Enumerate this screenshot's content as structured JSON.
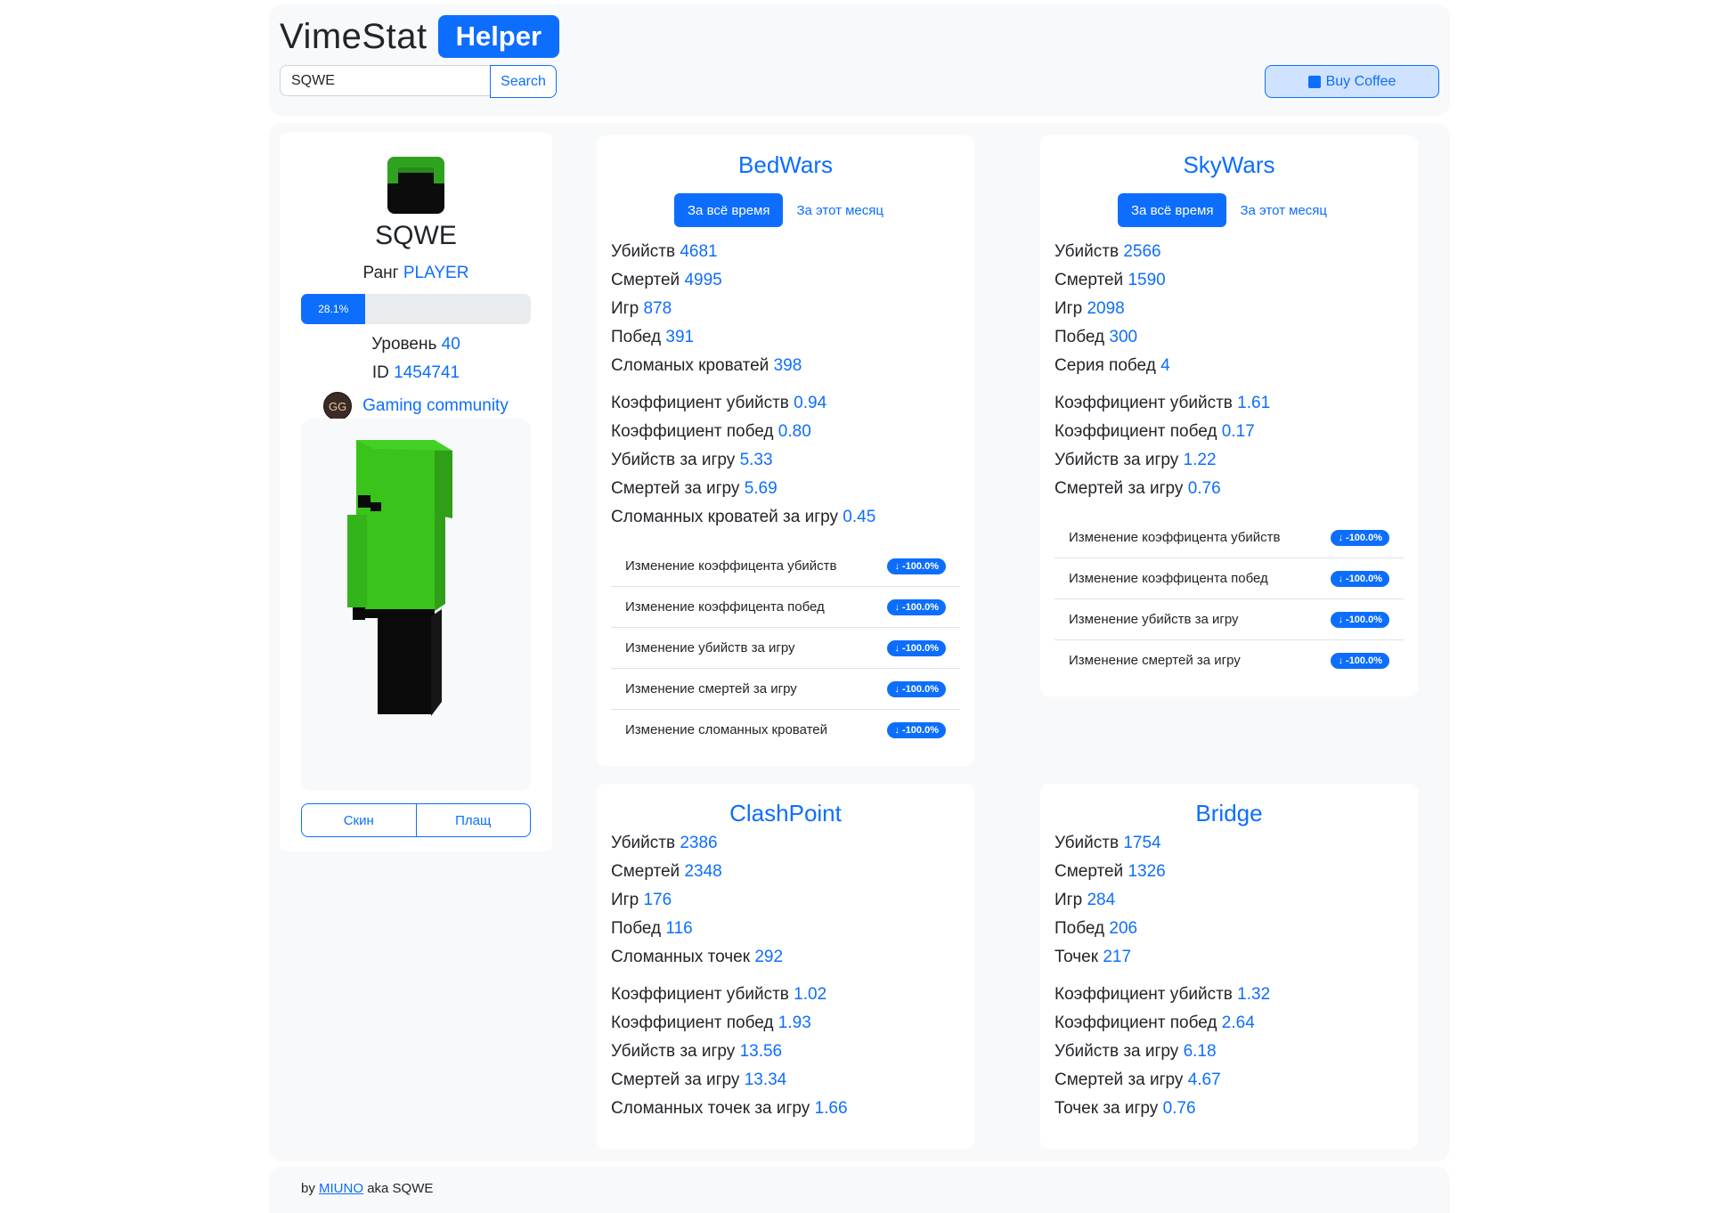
{
  "header": {
    "title": "VimeStat",
    "badge": "Helper",
    "search_value": "SQWE",
    "search_button": "Search",
    "coffee_button": "Buy Coffee"
  },
  "profile": {
    "name": "SQWE",
    "rank_label": "Ранг",
    "rank": "PLAYER",
    "progress_text": "28.1%",
    "progress_value": 28.1,
    "level_label": "Уровень",
    "level": "40",
    "id_label": "ID",
    "id": "1454741",
    "guild_icon_text": "GG",
    "guild": "Gaming community",
    "skin_button": "Скин",
    "cape_button": "Плащ"
  },
  "bedwars": {
    "title": "BedWars",
    "tab_all": "За всё время",
    "tab_month": "За этот месяц",
    "stats": [
      {
        "label": "Убийств",
        "value": "4681"
      },
      {
        "label": "Смертей",
        "value": "4995"
      },
      {
        "label": "Игр",
        "value": "878"
      },
      {
        "label": "Побед",
        "value": "391"
      },
      {
        "label": "Сломаных кроватей",
        "value": "398"
      }
    ],
    "ratios": [
      {
        "label": "Коэффициент убийств",
        "value": "0.94"
      },
      {
        "label": "Коэффициент побед",
        "value": "0.80"
      },
      {
        "label": "Убийств за игру",
        "value": "5.33"
      },
      {
        "label": "Смертей за игру",
        "value": "5.69"
      },
      {
        "label": "Сломанных кроватей за игру",
        "value": "0.45"
      }
    ],
    "changes": [
      {
        "label": "Изменение коэффицента убийств",
        "value": "↓ -100.0%"
      },
      {
        "label": "Изменение коэффицента побед",
        "value": "↓ -100.0%"
      },
      {
        "label": "Изменение убийств за игру",
        "value": "↓ -100.0%"
      },
      {
        "label": "Изменение смертей за игру",
        "value": "↓ -100.0%"
      },
      {
        "label": "Изменение сломанных кроватей",
        "value": "↓ -100.0%"
      }
    ]
  },
  "skywars": {
    "title": "SkyWars",
    "tab_all": "За всё время",
    "tab_month": "За этот месяц",
    "stats": [
      {
        "label": "Убийств",
        "value": "2566"
      },
      {
        "label": "Смертей",
        "value": "1590"
      },
      {
        "label": "Игр",
        "value": "2098"
      },
      {
        "label": "Побед",
        "value": "300"
      },
      {
        "label": "Серия побед",
        "value": "4"
      }
    ],
    "ratios": [
      {
        "label": "Коэффициент убийств",
        "value": "1.61"
      },
      {
        "label": "Коэффициент побед",
        "value": "0.17"
      },
      {
        "label": "Убийств за игру",
        "value": "1.22"
      },
      {
        "label": "Смертей за игру",
        "value": "0.76"
      }
    ],
    "changes": [
      {
        "label": "Изменение коэффицента убийств",
        "value": "↓ -100.0%"
      },
      {
        "label": "Изменение коэффицента побед",
        "value": "↓ -100.0%"
      },
      {
        "label": "Изменение убийств за игру",
        "value": "↓ -100.0%"
      },
      {
        "label": "Изменение смертей за игру",
        "value": "↓ -100.0%"
      }
    ]
  },
  "clashpoint": {
    "title": "ClashPoint",
    "stats": [
      {
        "label": "Убийств",
        "value": "2386"
      },
      {
        "label": "Смертей",
        "value": "2348"
      },
      {
        "label": "Игр",
        "value": "176"
      },
      {
        "label": "Побед",
        "value": "116"
      },
      {
        "label": "Сломанных точек",
        "value": "292"
      }
    ],
    "ratios": [
      {
        "label": "Коэффициент убийств",
        "value": "1.02"
      },
      {
        "label": "Коэффициент побед",
        "value": "1.93"
      },
      {
        "label": "Убийств за игру",
        "value": "13.56"
      },
      {
        "label": "Смертей за игру",
        "value": "13.34"
      },
      {
        "label": "Сломанных точек за игру",
        "value": "1.66"
      }
    ]
  },
  "bridge": {
    "title": "Bridge",
    "stats": [
      {
        "label": "Убийств",
        "value": "1754"
      },
      {
        "label": "Смертей",
        "value": "1326"
      },
      {
        "label": "Игр",
        "value": "284"
      },
      {
        "label": "Побед",
        "value": "206"
      },
      {
        "label": "Точек",
        "value": "217"
      }
    ],
    "ratios": [
      {
        "label": "Коэффициент убийств",
        "value": "1.32"
      },
      {
        "label": "Коэффициент побед",
        "value": "2.64"
      },
      {
        "label": "Убийств за игру",
        "value": "6.18"
      },
      {
        "label": "Смертей за игру",
        "value": "4.67"
      },
      {
        "label": "Точек за игру",
        "value": "0.76"
      }
    ]
  },
  "footer": {
    "by": "by",
    "author": "MIUNO",
    "aka": "aka SQWE"
  },
  "colors": {
    "accent": "#0d6efd",
    "panel": "#f8f9fa",
    "skin_green": "#39c31b",
    "skin_black": "#0a0a0a"
  },
  "icons": [
    "coffee-icon",
    "guild-icon",
    "avatar-head-icon"
  ]
}
